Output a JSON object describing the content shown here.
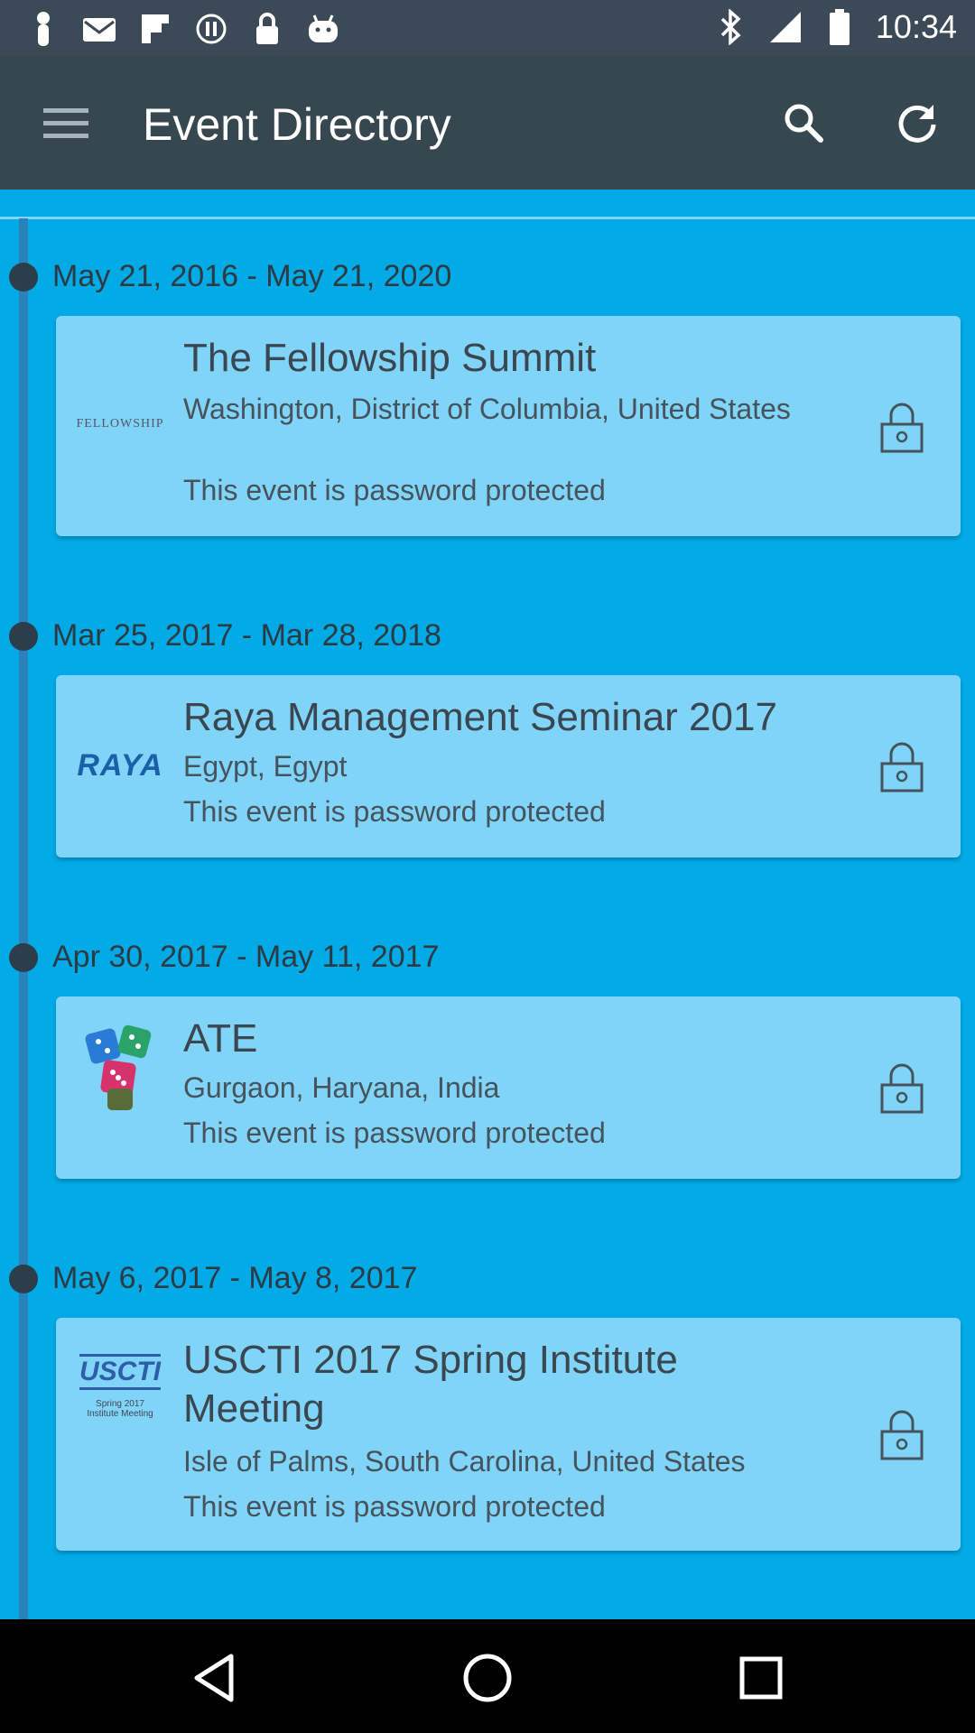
{
  "status_bar": {
    "time": "10:34",
    "left_icons": [
      "notification-icon",
      "mail-icon",
      "flipboard-icon",
      "sync-icon",
      "lock-icon",
      "android-icon"
    ],
    "right_icons": [
      "bluetooth-icon",
      "signal-icon",
      "battery-icon"
    ]
  },
  "app_bar": {
    "title": "Event Directory",
    "background": "#37474f"
  },
  "colors": {
    "content_bg": "#02aae6",
    "card_bg": "#80d4f7",
    "timeline": "#2b82b8",
    "dot": "#2c3e4a"
  },
  "events": [
    {
      "date_range": "May 21, 2016 - May 21, 2020",
      "name": "The Fellowship Summit",
      "location": "Washington, District of Columbia, United States",
      "status": "This event is password protected",
      "logo": "FELLOWSHIP"
    },
    {
      "date_range": "Mar 25, 2017 - Mar 28, 2018",
      "name": "Raya Management Seminar 2017",
      "location": "Egypt, Egypt",
      "status": "This event is password protected",
      "logo": "RAYA"
    },
    {
      "date_range": "Apr 30, 2017 - May 11, 2017",
      "name": "ATE",
      "location": "Gurgaon, Haryana, India",
      "status": "This event is password protected",
      "logo": "dice-logo"
    },
    {
      "date_range": "May 6, 2017 - May 8, 2017",
      "name": "USCTI 2017 Spring Institute Meeting",
      "location": "Isle of Palms, South Carolina, United States",
      "status": "This event is password protected",
      "logo": "USCTI",
      "logo_caption_1": "Spring 2017",
      "logo_caption_2": "Institute Meeting"
    }
  ],
  "nav_bar": {
    "buttons": [
      "back-icon",
      "home-icon",
      "recents-icon"
    ]
  }
}
